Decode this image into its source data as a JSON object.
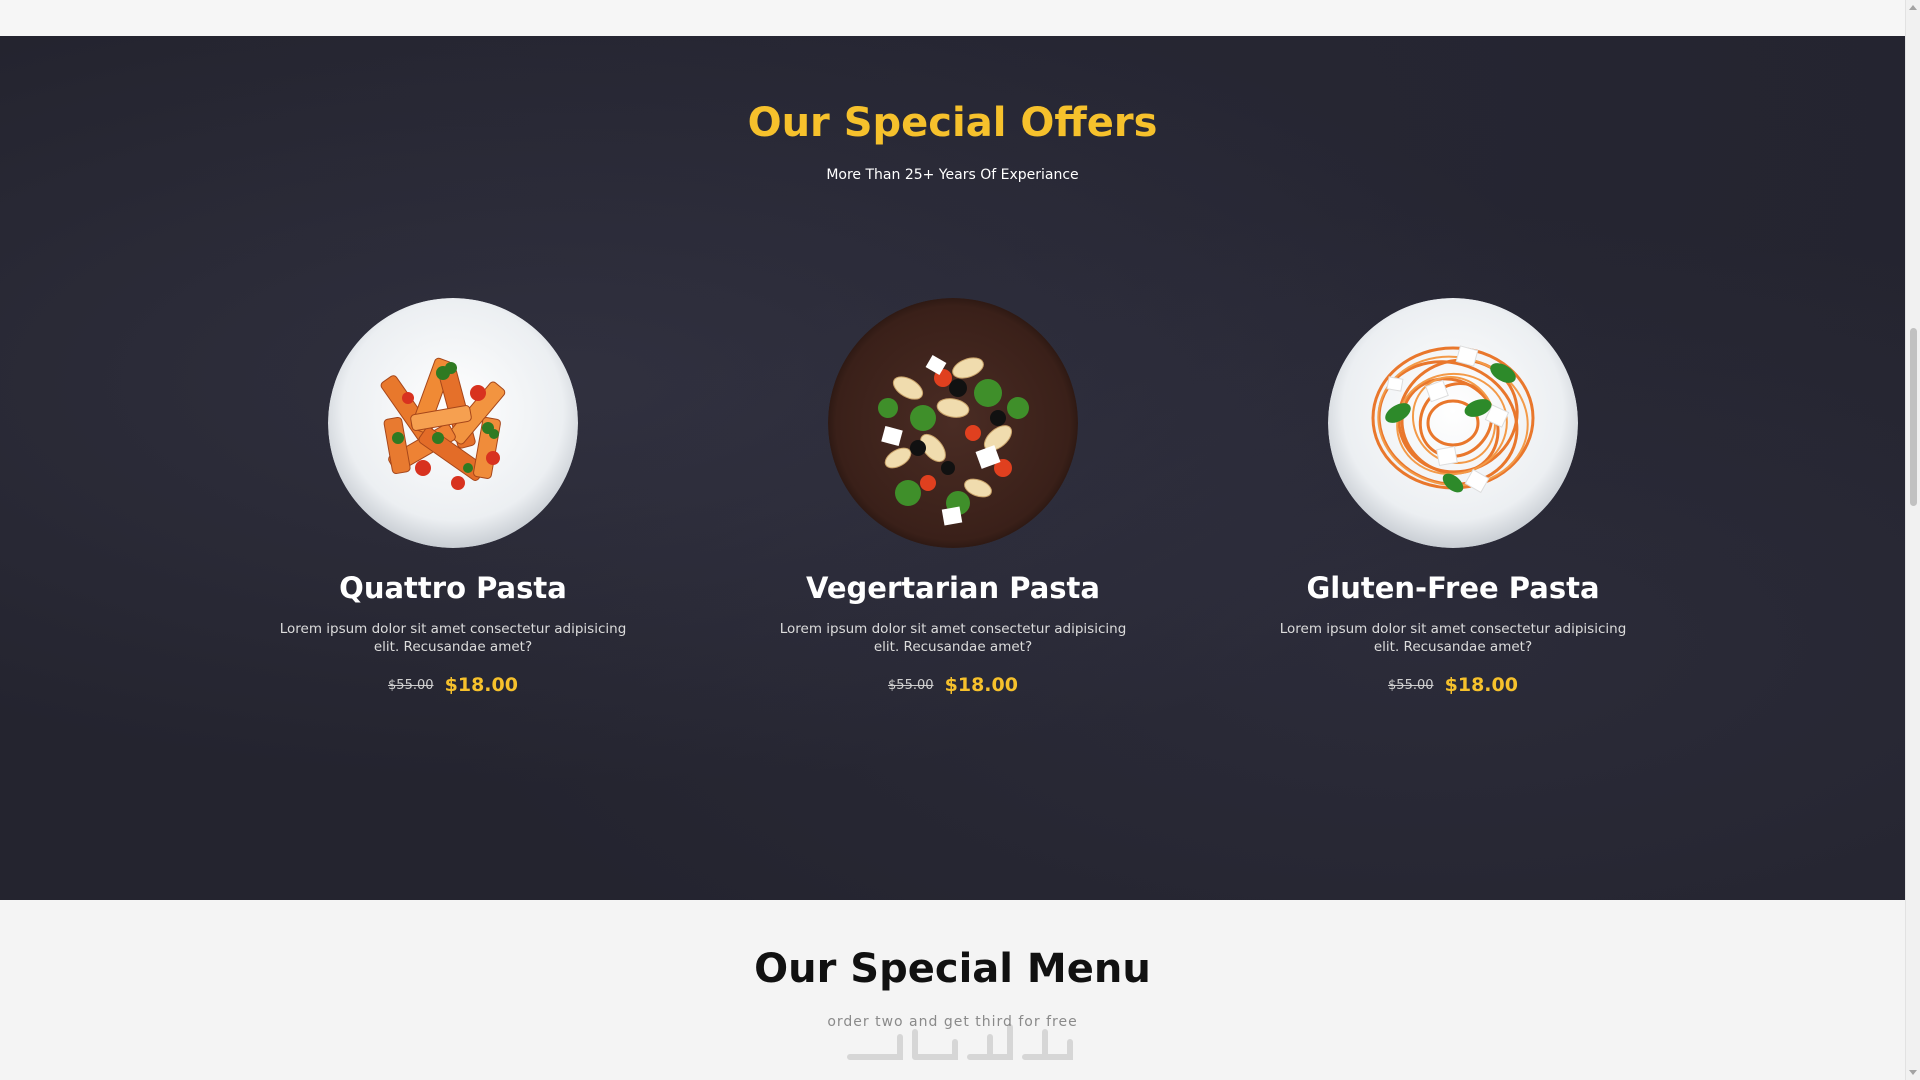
{
  "offers": {
    "title": "Our Special Offers",
    "subtitle": "More Than 25+ Years Of Experiance",
    "items": [
      {
        "name": "Quattro Pasta",
        "description": "Lorem ipsum dolor sit amet consectetur adipisicing elit. Recusandae amet?",
        "old_price": "$55.00",
        "new_price": "$18.00",
        "image": "penne-pasta-plate-image"
      },
      {
        "name": "Vegertarian Pasta",
        "description": "Lorem ipsum dolor sit amet consectetur adipisicing elit. Recusandae amet?",
        "old_price": "$55.00",
        "new_price": "$18.00",
        "image": "vegetable-fusilli-bowl-image"
      },
      {
        "name": "Gluten-Free Pasta",
        "description": "Lorem ipsum dolor sit amet consectetur adipisicing elit. Recusandae amet?",
        "old_price": "$55.00",
        "new_price": "$18.00",
        "image": "spaghetti-plate-image"
      }
    ]
  },
  "menu": {
    "title": "Our Special Menu",
    "subtitle": "order two and get third for free"
  },
  "colors": {
    "accent": "#f6c12c",
    "dark_bg": "#24242f",
    "light_bg": "#f4f4f4"
  }
}
